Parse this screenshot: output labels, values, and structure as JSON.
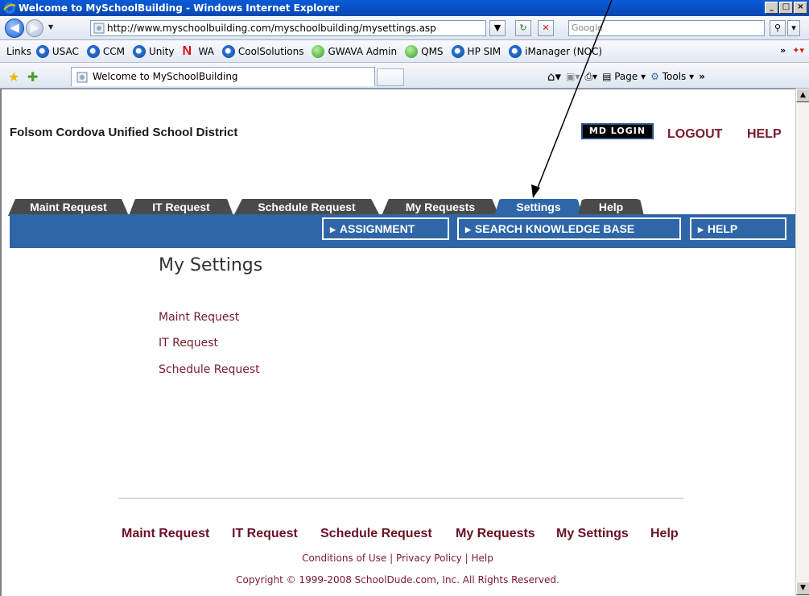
{
  "window": {
    "title": "Welcome to MySchoolBuilding - Windows Internet Explorer"
  },
  "address": {
    "url": "http://www.myschoolbuilding.com/myschoolbuilding/mysettings.asp",
    "search_placeholder": "Google"
  },
  "links_bar": {
    "label": "Links",
    "items": [
      "USAC",
      "CCM",
      "Unity",
      "WA",
      "CoolSolutions",
      "GWAVA Admin",
      "QMS",
      "HP SIM",
      "iManager (NOC)"
    ],
    "chevron": "»"
  },
  "command_bar": {
    "tab_title": "Welcome to MySchoolBuilding",
    "page_label": "Page",
    "tools_label": "Tools"
  },
  "header": {
    "district": "Folsom Cordova Unified School District",
    "md_login": "MD LOGIN",
    "logout": "LOGOUT",
    "help": "HELP"
  },
  "tabs": [
    "Maint Request",
    "IT Request",
    "Schedule Request",
    "My Requests",
    "Settings",
    "Help"
  ],
  "active_tab": "Settings",
  "subnav": [
    "ASSIGNMENT",
    "SEARCH KNOWLEDGE BASE",
    "HELP"
  ],
  "main": {
    "heading": "My Settings",
    "links": [
      "Maint Request",
      "IT Request",
      "Schedule Request"
    ]
  },
  "footer": {
    "nav": [
      "Maint Request",
      "IT Request",
      "Schedule Request",
      "My Requests",
      "My Settings",
      "Help"
    ],
    "legal": [
      "Conditions of Use",
      "Privacy Policy",
      "Help"
    ],
    "separator": "|",
    "copyright": "Copyright © 1999-2008 SchoolDude.com, Inc. All Rights Reserved."
  },
  "colors": {
    "tab_active": "#2e66a8",
    "tab_inactive": "#4a4a4a",
    "link": "#7b1a2c",
    "title_bar": "#0a5bd8"
  }
}
